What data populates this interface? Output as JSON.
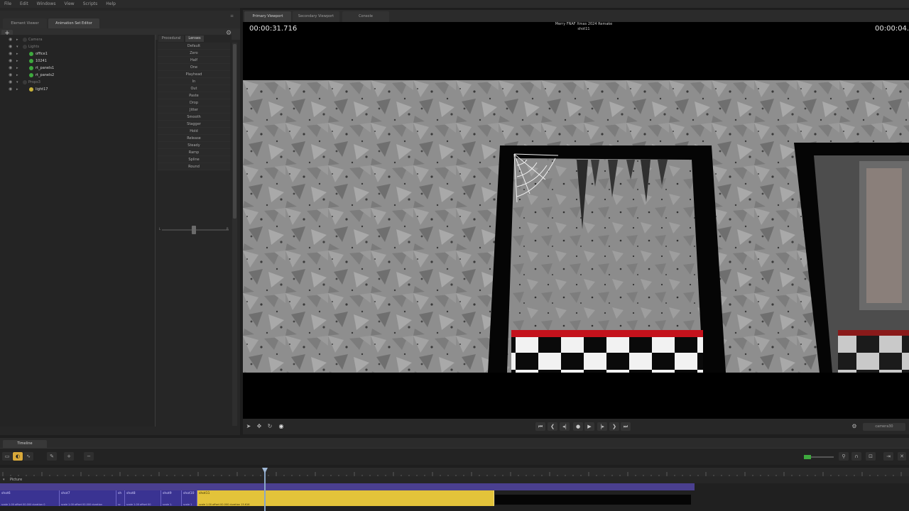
{
  "menubar": [
    "File",
    "Edit",
    "Windows",
    "View",
    "Scripts",
    "Help"
  ],
  "left_tabs": [
    "Element Viewer",
    "Animation Set Editor"
  ],
  "tree": [
    {
      "label": "Camera",
      "dot": "none",
      "child": false
    },
    {
      "label": "Lights",
      "dot": "none",
      "child": false
    },
    {
      "label": "office1",
      "dot": "green",
      "child": true
    },
    {
      "label": "10241",
      "dot": "green",
      "child": true
    },
    {
      "label": "rt_panels1",
      "dot": "green",
      "child": true
    },
    {
      "label": "rt_panels2",
      "dot": "green",
      "child": true
    },
    {
      "label": "Props3",
      "dot": "none",
      "child": false
    },
    {
      "label": "light17",
      "dot": "yellow",
      "child": true
    }
  ],
  "preset_tabs": [
    "Procedural",
    "Lenses"
  ],
  "presets": [
    "Default",
    "Zero",
    "Half",
    "One",
    "Playhead",
    "In",
    "Out",
    "Paste",
    "Drop",
    "Jitter",
    "Smooth",
    "Stagger",
    "Hold",
    "Release",
    "Steady",
    "Ramp",
    "Spline",
    "Round"
  ],
  "slider": {
    "left": "L",
    "right": "R"
  },
  "viewport_tabs": [
    "Primary Viewport",
    "Secondary Viewport",
    "Console"
  ],
  "viewport": {
    "time_left": "00:00:31.716",
    "time_right": "00:00:04.4",
    "title_line1": "Merry FNAF Xmas 2024 Remake",
    "title_line2": "shot11"
  },
  "camera_select": "camera30",
  "timeline_tab": "Timeline",
  "track_label": "Picture",
  "shots": [
    {
      "name": "shot6",
      "info": "scale 1.00  offset 00.000  duration 0"
    },
    {
      "name": "shot7",
      "info": "scale 1.00  offset 00.000  duration"
    },
    {
      "name": "sh",
      "info": "sc"
    },
    {
      "name": "shot8",
      "info": "scale 1.00  offset 00"
    },
    {
      "name": "shot9",
      "info": "scale 1."
    },
    {
      "name": "shot10",
      "info": "scale 1"
    },
    {
      "name": "shot11",
      "info": "scale 1.00  offset 00.000  duration 15.616"
    }
  ],
  "colors": {
    "accent_yellow": "#e3c33a",
    "shot_purple": "#3a3392",
    "floor_red": "#c4121c"
  }
}
